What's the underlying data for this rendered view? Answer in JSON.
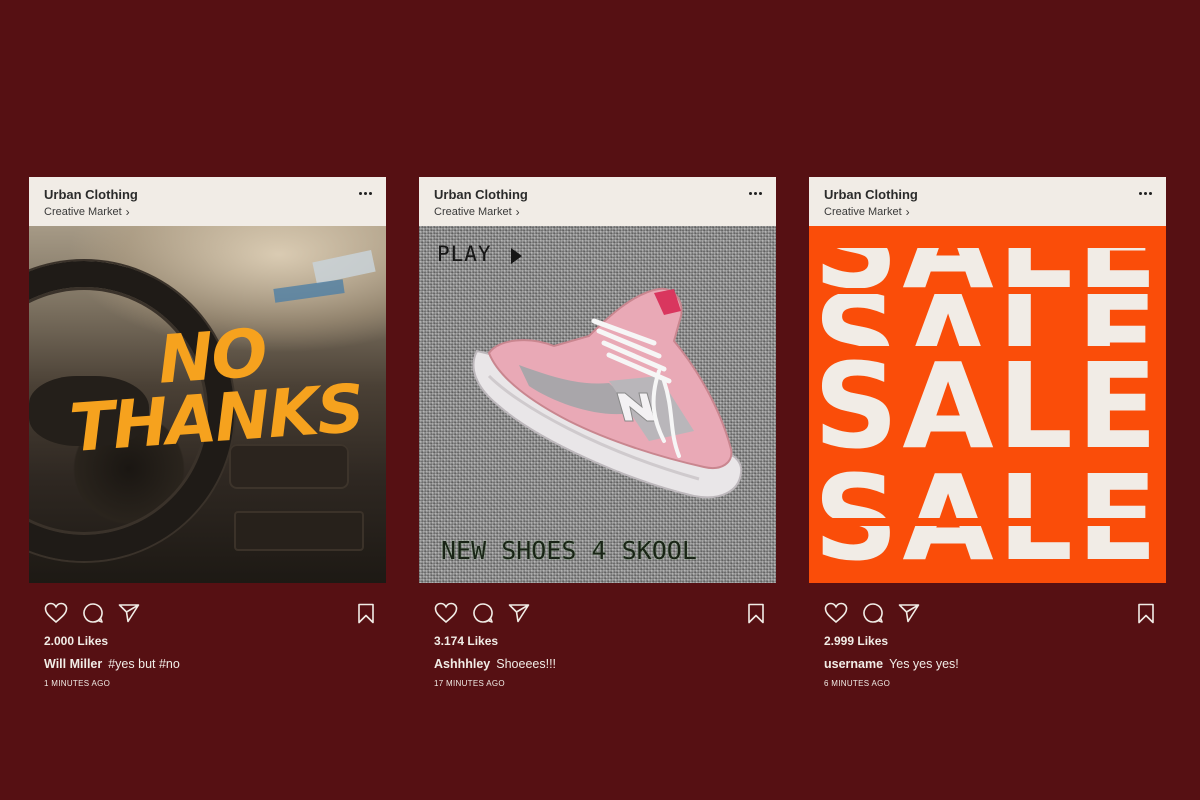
{
  "posts": [
    {
      "account": "Urban Clothing",
      "subtitle": "Creative Market",
      "image_text": [
        "NO",
        "THANKS"
      ],
      "likes": "2.000 Likes",
      "username": "Will Miller",
      "caption": "#yes but #no",
      "time": "1 MINUTES AGO"
    },
    {
      "account": "Urban Clothing",
      "subtitle": "Creative Market",
      "image_top": "PLAY",
      "image_bottom": "NEW SHOES 4 SKOOL",
      "likes": "3.174 Likes",
      "username": "Ashhhley",
      "caption": "Shoeees!!!",
      "time": "17 MINUTES AGO"
    },
    {
      "account": "Urban Clothing",
      "subtitle": "Creative Market",
      "image_text": "SALE",
      "likes": "2.999 Likes",
      "username": "username",
      "caption": "Yes yes yes!",
      "time": "6 MINUTES AGO"
    }
  ],
  "colors": {
    "background": "#561013",
    "header": "#f1ece6",
    "sale_orange": "#fa4d09",
    "no_thanks_orange": "#f6a21e"
  },
  "icons": [
    "more-icon",
    "heart-icon",
    "comment-icon",
    "share-icon",
    "bookmark-icon",
    "play-icon",
    "chevron-right-icon"
  ]
}
